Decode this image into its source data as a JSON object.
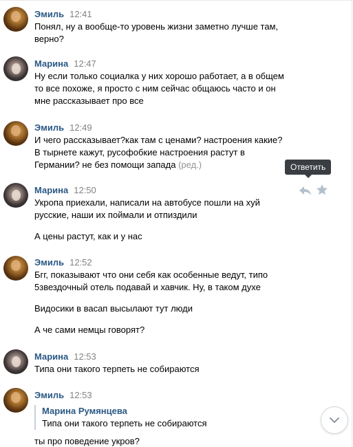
{
  "messages": [
    {
      "author": "Эмиль",
      "time": "12:41",
      "lines": [
        "Понял, ну а вообще-то уровень жизни заметно лучше там,",
        "верно?"
      ]
    },
    {
      "author": "Марина",
      "time": "12:47",
      "lines": [
        "Ну если только социалка у них хорошо работает, а в общем",
        "то все похоже, я просто с ним сейчас общаюсь часто и он",
        "мне рассказывает про все"
      ]
    },
    {
      "author": "Эмиль",
      "time": "12:49",
      "lines": [
        "И чего рассказывает?как там с ценами? настроения какие?",
        "В тырнете кажут, русофобкие настроения растут в"
      ],
      "last_line": "Германии? не без помощи запада",
      "edited_label": "(ред.)"
    },
    {
      "author": "Марина",
      "time": "12:50",
      "lines": [
        "Укропа приехали, написали на автобусе пошли на хуй",
        "русские, наши их поймали и отпиздили"
      ],
      "paragraph2": "А цены растут, как и у нас"
    },
    {
      "author": "Эмиль",
      "time": "12:52",
      "lines": [
        "Бгг, показывают что они себя как особенные ведут, типо",
        "5звездочный отель подавай и хавчик. Ну, в таком духе"
      ],
      "paragraph2": "Видосики в васап высылают тут люди",
      "paragraph3": "А че сами немцы говорят?"
    },
    {
      "author": "Марина",
      "time": "12:53",
      "lines": [
        "Типа они такого терпеть не собираются"
      ]
    },
    {
      "author": "Эмиль",
      "time": "12:53",
      "quote": {
        "author": "Марина Румянцева",
        "text": "Типа они такого терпеть не собираются"
      },
      "lines": [
        "ты про поведение укров?"
      ]
    }
  ],
  "actions": {
    "reply_tooltip": "Ответить",
    "reply_icon": "reply-arrow-icon",
    "favorite_icon": "star-icon",
    "scroll_down_icon": "chevron-down-icon"
  },
  "colors": {
    "author": "#2a5885",
    "time": "#828282",
    "edited": "#939393",
    "tooltip_bg": "#3a3d42",
    "quote_border": "#c5d0db"
  }
}
